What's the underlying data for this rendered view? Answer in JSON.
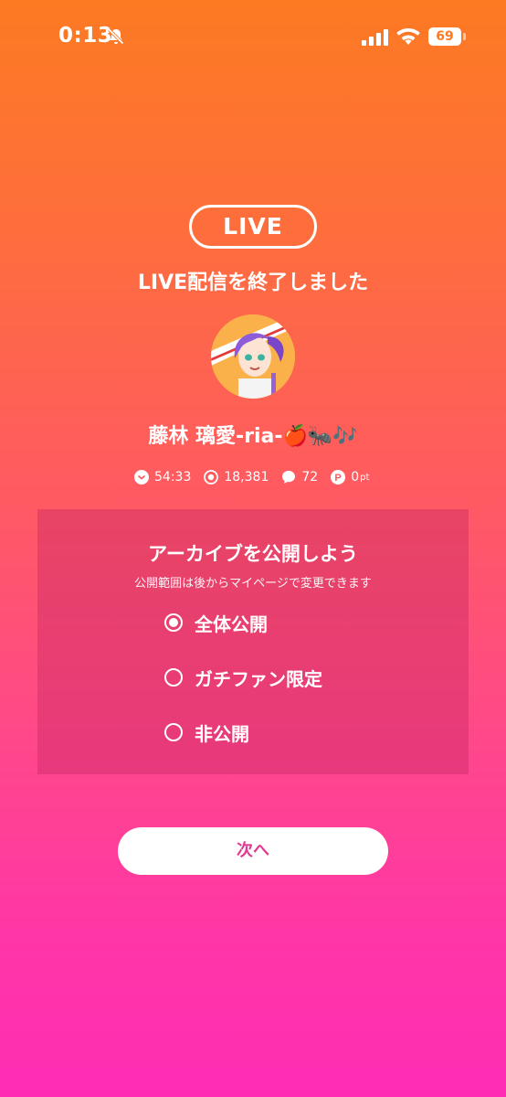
{
  "status_bar": {
    "time": "0:13",
    "battery": "69"
  },
  "live": {
    "badge": "LIVE",
    "ended_message": "LIVE配信を終了しました"
  },
  "profile": {
    "username": "藤林 璃愛-ria-🍎🐜🎶"
  },
  "stats": {
    "duration": "54:33",
    "viewers": "18,381",
    "comments": "72",
    "points": "0",
    "points_unit": "pt"
  },
  "archive": {
    "title": "アーカイブを公開しよう",
    "subtitle": "公開範囲は後からマイページで変更できます",
    "options": [
      {
        "label": "全体公開",
        "checked": true
      },
      {
        "label": "ガチファン限定",
        "checked": false
      },
      {
        "label": "非公開",
        "checked": false
      }
    ]
  },
  "next_button": {
    "label": "次へ"
  },
  "colors": {
    "gradient_top": "#fd7a22",
    "gradient_bottom": "#ff2db4",
    "button_text": "#e23a92"
  }
}
